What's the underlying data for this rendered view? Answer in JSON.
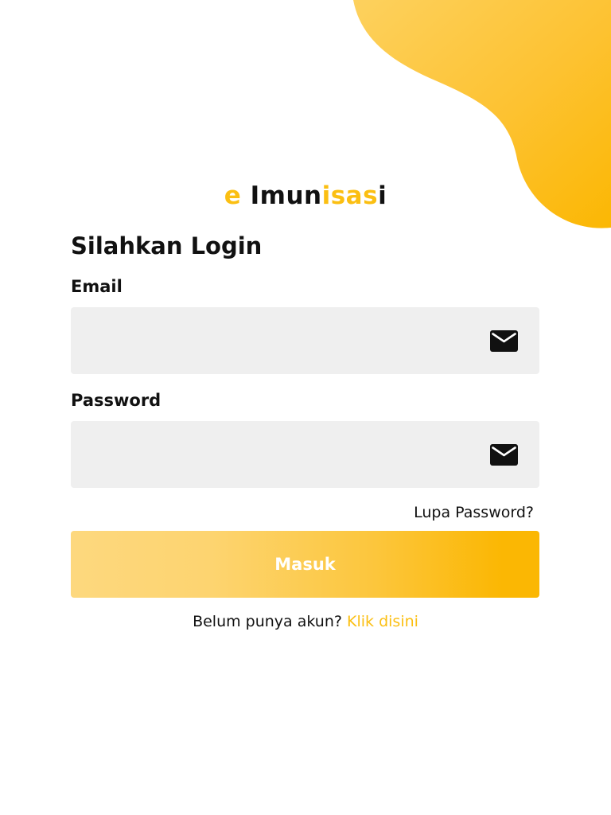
{
  "brand": {
    "parts": [
      "e",
      " ",
      "Imun",
      "isas",
      "i"
    ],
    "accent_color": "#fbbf12",
    "text_color": "#111111"
  },
  "login": {
    "heading": "Silahkan Login",
    "email_label": "Email",
    "email_value": "",
    "email_icon": "mail-icon",
    "password_label": "Password",
    "password_value": "",
    "password_icon": "mail-icon",
    "forgot_label": "Lupa Password?",
    "submit_label": "Masuk",
    "register_prompt": "Belum punya akun?",
    "register_link": "Klik disini"
  },
  "colors": {
    "accent": "#fbbf12",
    "input_bg": "#efefef",
    "button_gradient_start": "#fdd87e",
    "button_gradient_end": "#fbb703"
  }
}
